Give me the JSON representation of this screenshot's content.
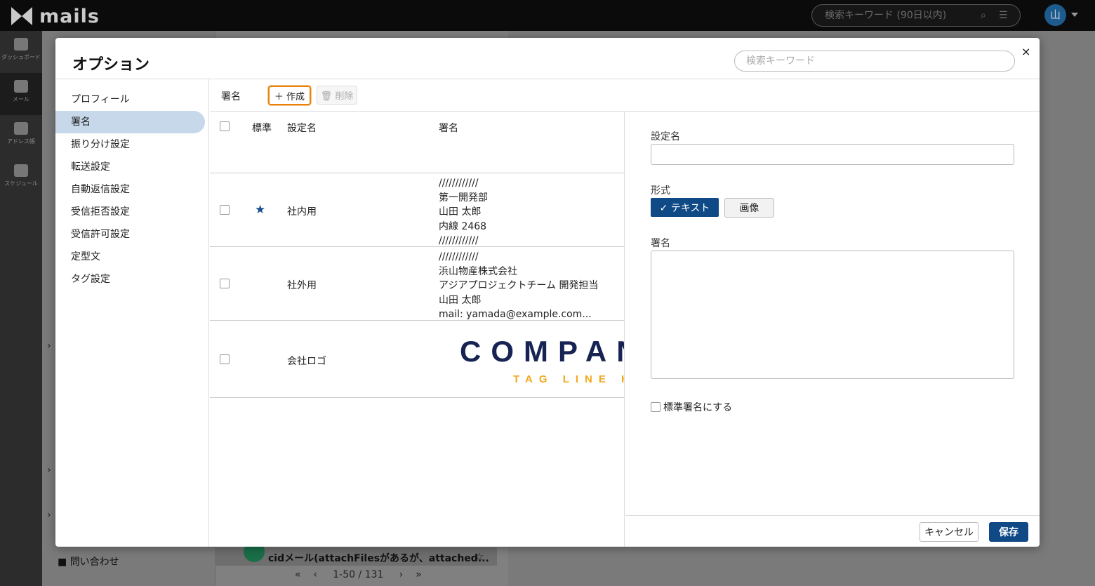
{
  "app": {
    "logo_text": "mails",
    "search_placeholder": "検索キーワード (90日以内)",
    "avatar_initial": "山",
    "nav": [
      {
        "label": "ダッシュボード",
        "icon": "dashboard-icon"
      },
      {
        "label": "メール",
        "icon": "mail-icon"
      },
      {
        "label": "アドレス帳",
        "icon": "address-book-icon"
      },
      {
        "label": "スケジュール",
        "icon": "calendar-icon"
      }
    ],
    "inquiry_folder": "問い合わせ",
    "mail_preview_subject": "cidメール(attachFilesがあるが、attached...",
    "mail_badge": "Q",
    "pager_text": "1-50 / 131"
  },
  "modal": {
    "title": "オプション",
    "search_placeholder": "検索キーワード",
    "close_label": "×",
    "sidebar": [
      {
        "label": "プロフィール"
      },
      {
        "label": "署名",
        "active": true
      },
      {
        "label": "振り分け設定"
      },
      {
        "label": "転送設定"
      },
      {
        "label": "自動返信設定"
      },
      {
        "label": "受信拒否設定"
      },
      {
        "label": "受信許可設定"
      },
      {
        "label": "定型文"
      },
      {
        "label": "タグ設定"
      }
    ],
    "toolbar": {
      "section_label": "署名",
      "create_label": "＋ 作成",
      "delete_label": "削除"
    },
    "table": {
      "headers": {
        "default": "標準",
        "name": "設定名",
        "signature": "署名"
      },
      "rows": [
        {
          "is_default": true,
          "name": "社内用",
          "signature_lines": [
            "////////////",
            "第一開発部",
            "山田 太郎",
            "内線 2468",
            "////////////"
          ]
        },
        {
          "is_default": false,
          "name": "社外用",
          "signature_lines": [
            "////////////",
            "浜山物産株式会社",
            "アジアプロジェクトチーム 開発担当",
            "山田 太郎",
            "mail: yamada@example.com..."
          ]
        },
        {
          "is_default": false,
          "name": "会社ロゴ",
          "image_text": "COMPANY",
          "image_tagline": "TAG LINE HERE"
        }
      ]
    },
    "form": {
      "name_label": "設定名",
      "name_value": "",
      "format_label": "形式",
      "format_text": "✓ テキスト",
      "format_image": "画像",
      "signature_label": "署名",
      "signature_value": "",
      "default_checkbox_label": "標準署名にする",
      "cancel_label": "キャンセル",
      "save_label": "保存"
    }
  },
  "colors": {
    "primary": "#0f4a86",
    "active_sidebar": "#c6d8ea",
    "focus_outline": "#e8820c",
    "logo_navy": "#162353",
    "logo_gold": "#f2a81c"
  }
}
